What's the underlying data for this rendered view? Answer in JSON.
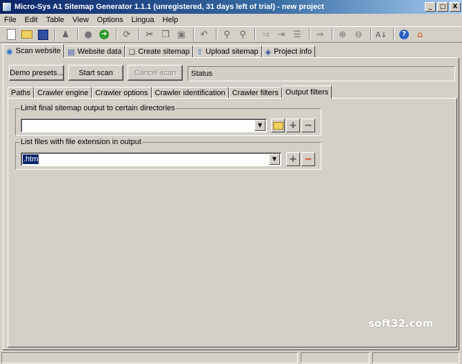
{
  "window": {
    "title": "Micro-Sys A1 Sitemap Generator 1.1.1 (unregistered, 31 days left of trial) - new project",
    "controls": [
      "_",
      "□",
      "X"
    ]
  },
  "menu": [
    "File",
    "Edit",
    "Table",
    "View",
    "Options",
    "Lingua",
    "Help"
  ],
  "toolbar": {
    "buttons": [
      "new-file",
      "open-folder",
      "save",
      "pin",
      "stop",
      "go-arrow",
      "refresh",
      "cut",
      "copy",
      "paste",
      "undo",
      "find",
      "find-replace",
      "align-left",
      "indent",
      "align-distribute",
      "move-right",
      "expand",
      "collapse",
      "sort",
      "help",
      "home"
    ]
  },
  "main_tabs": [
    {
      "label": "Scan website",
      "icon": "scan-icon",
      "active": true
    },
    {
      "label": "Website data",
      "icon": "chart-icon",
      "active": false
    },
    {
      "label": "Create sitemap",
      "icon": "document-icon",
      "active": false
    },
    {
      "label": "Upload sitemap",
      "icon": "upload-icon",
      "active": false
    },
    {
      "label": "Project info",
      "icon": "info-icon",
      "active": false
    }
  ],
  "actions": {
    "demo_presets": "Demo presets...",
    "start_scan": "Start scan",
    "cancel_scan": "Cancel scan",
    "status": "Status"
  },
  "sub_tabs": [
    {
      "label": "Paths",
      "active": false
    },
    {
      "label": "Crawler engine",
      "active": false
    },
    {
      "label": "Crawler options",
      "active": false
    },
    {
      "label": "Crawler identification",
      "active": false
    },
    {
      "label": "Crawler filters",
      "active": false
    },
    {
      "label": "Output filters",
      "active": true
    }
  ],
  "limit_dirs": {
    "label": "Limit final sitemap output to certain directories",
    "value": ""
  },
  "file_ext": {
    "label": "List files with file extension in output",
    "value": ".htm"
  },
  "watermark": "soft32.com",
  "colors": {
    "title_start": "#0a246a",
    "title_end": "#a6caf0",
    "face": "#d4d0c8",
    "selection": "#0a246a"
  }
}
